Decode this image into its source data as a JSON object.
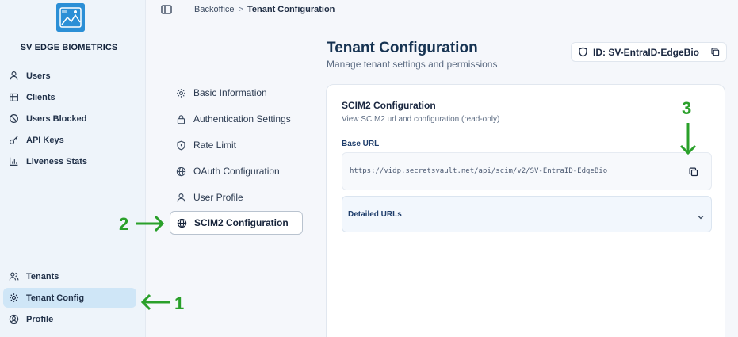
{
  "brand": {
    "name": "SV EDGE BIOMETRICS"
  },
  "sidebar": {
    "top_items": [
      {
        "label": "Users",
        "icon": "user-icon"
      },
      {
        "label": "Clients",
        "icon": "building-icon"
      },
      {
        "label": "Users Blocked",
        "icon": "ban-icon"
      },
      {
        "label": "API Keys",
        "icon": "key-icon"
      },
      {
        "label": "Liveness Stats",
        "icon": "chart-icon"
      }
    ],
    "bottom_items": [
      {
        "label": "Tenants",
        "icon": "users-icon"
      },
      {
        "label": "Tenant Config",
        "icon": "gear-icon",
        "active": true
      },
      {
        "label": "Profile",
        "icon": "user-circle-icon"
      }
    ]
  },
  "breadcrumb": {
    "parent": "Backoffice",
    "separator": ">",
    "current": "Tenant Configuration"
  },
  "header": {
    "title": "Tenant Configuration",
    "subtitle": "Manage tenant settings and permissions",
    "tenant_id": "ID: SV-EntraID-EdgeBio"
  },
  "settings_menu": [
    {
      "label": "Basic Information",
      "icon": "gear-icon"
    },
    {
      "label": "Authentication Settings",
      "icon": "lock-icon"
    },
    {
      "label": "Rate Limit",
      "icon": "shield-icon"
    },
    {
      "label": "OAuth Configuration",
      "icon": "globe-icon"
    },
    {
      "label": "User Profile",
      "icon": "user-icon"
    },
    {
      "label": "SCIM2 Configuration",
      "icon": "globe-icon",
      "active": true
    }
  ],
  "scim": {
    "title": "SCIM2 Configuration",
    "description": "View SCIM2 url and configuration (read-only)",
    "base_url_label": "Base URL",
    "base_url": "https://vidp.secretsvault.net/api/scim/v2/SV-EntraID-EdgeBio",
    "detailed_label": "Detailed URLs"
  },
  "annotations": {
    "one": "1",
    "two": "2",
    "three": "3"
  },
  "colors": {
    "accent": "#2b8fd6",
    "annotation": "#2aa02a",
    "active_nav": "#cfe6f7"
  }
}
